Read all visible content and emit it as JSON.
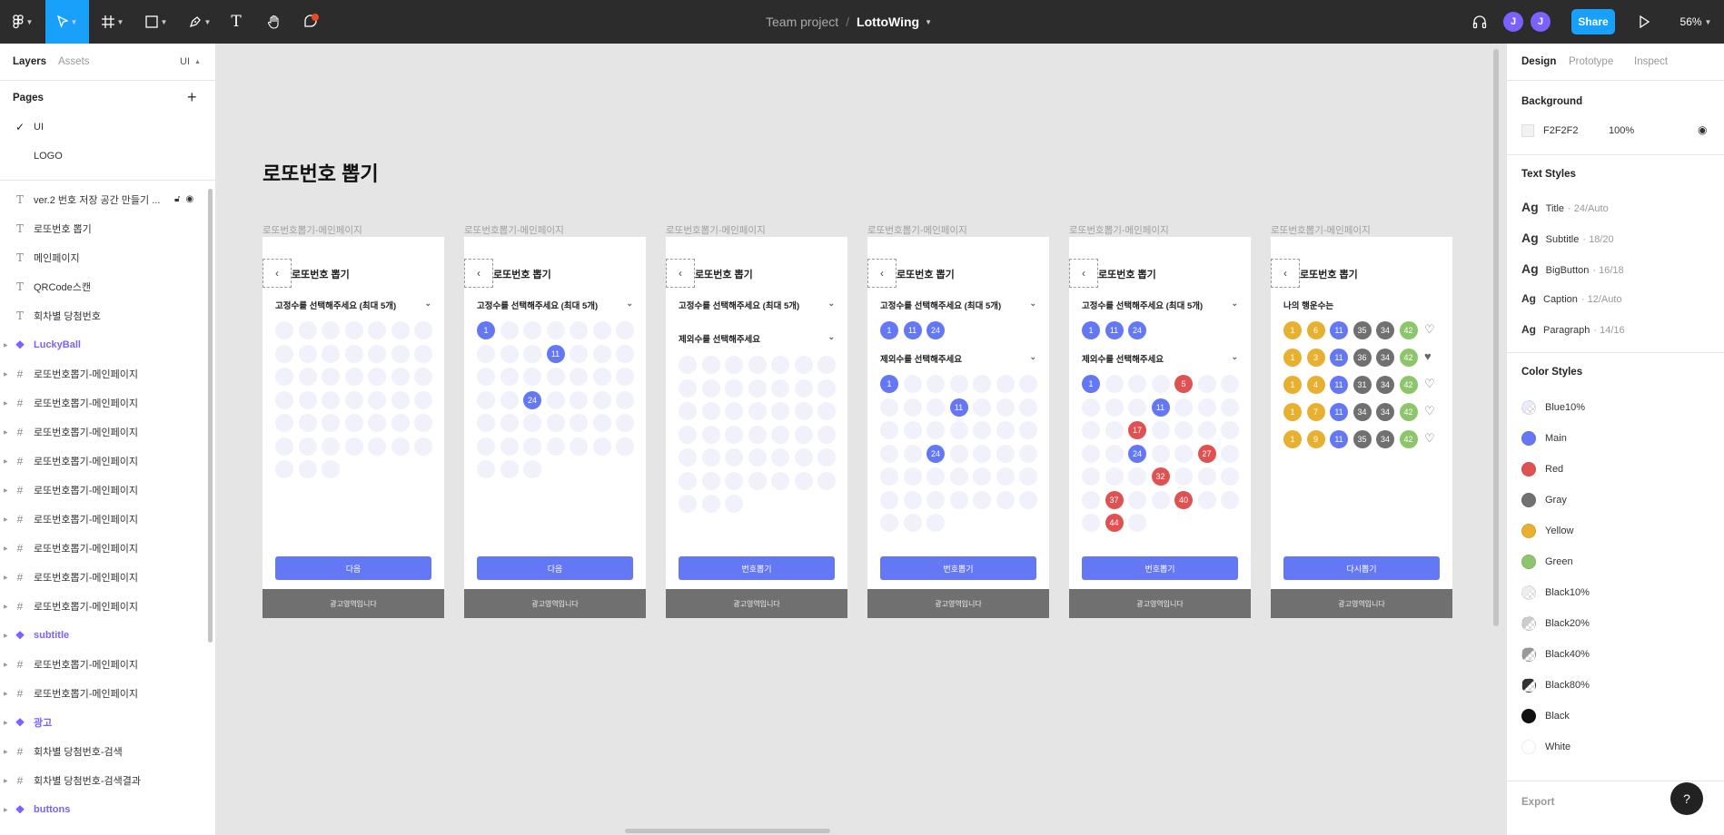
{
  "topbar": {
    "project": "Team project",
    "separator": "/",
    "file_name": "LottoWing",
    "avatars": [
      "J",
      "J"
    ],
    "share_label": "Share",
    "zoom": "56%"
  },
  "left_panel": {
    "tabs": {
      "layers": "Layers",
      "assets": "Assets",
      "page_select": "UI"
    },
    "pages_label": "Pages",
    "pages": [
      {
        "name": "UI",
        "selected": true
      },
      {
        "name": "LOGO",
        "selected": false
      }
    ],
    "layers": [
      {
        "type": "text",
        "name": "ver.2 번호 저장 공간 만들기 ..."
      },
      {
        "type": "text",
        "name": "로또번호 뽑기"
      },
      {
        "type": "text",
        "name": "메인페이지"
      },
      {
        "type": "text",
        "name": "QRCode스캔"
      },
      {
        "type": "text",
        "name": "회차별 당첨번호"
      },
      {
        "type": "component",
        "name": "LuckyBall"
      },
      {
        "type": "frame",
        "name": "로또번호뽑기-메인페이지"
      },
      {
        "type": "frame",
        "name": "로또번호뽑기-메인페이지"
      },
      {
        "type": "frame",
        "name": "로또번호뽑기-메인페이지"
      },
      {
        "type": "frame",
        "name": "로또번호뽑기-메인페이지"
      },
      {
        "type": "frame",
        "name": "로또번호뽑기-메인페이지"
      },
      {
        "type": "frame",
        "name": "로또번호뽑기-메인페이지"
      },
      {
        "type": "frame",
        "name": "로또번호뽑기-메인페이지"
      },
      {
        "type": "frame",
        "name": "로또번호뽑기-메인페이지"
      },
      {
        "type": "frame",
        "name": "로또번호뽑기-메인페이지"
      },
      {
        "type": "component",
        "name": "subtitle"
      },
      {
        "type": "frame",
        "name": "로또번호뽑기-메인페이지"
      },
      {
        "type": "frame",
        "name": "로또번호뽑기-메인페이지"
      },
      {
        "type": "component",
        "name": "광고"
      },
      {
        "type": "frame",
        "name": "회차별 당첨번호-검색"
      },
      {
        "type": "frame",
        "name": "회차별 당첨번호-검색결과"
      },
      {
        "type": "component",
        "name": "buttons"
      }
    ]
  },
  "canvas": {
    "heading": "로또번호 뽑기",
    "frames": [
      {
        "label": "로또번호뽑기-메인페이지",
        "title": "로또번호 뽑기",
        "drop1": "고정수를 선택해주세요 (최대 5개)",
        "drop2": "",
        "button": "다음",
        "ad": "광고영역입니다",
        "mode": "grid1",
        "selected": []
      },
      {
        "label": "로또번호뽑기-메인페이지",
        "title": "로또번호 뽑기",
        "drop1": "고정수를 선택해주세요 (최대 5개)",
        "drop2": "",
        "button": "다음",
        "ad": "광고영역입니다",
        "mode": "grid1",
        "selected": [
          1,
          11,
          24
        ]
      },
      {
        "label": "로또번호뽑기-메인페이지",
        "title": "로또번호 뽑기",
        "drop1": "고정수를 선택해주세요 (최대 5개)",
        "drop2": "제외수를 선택해주세요",
        "button": "번호뽑기",
        "ad": "광고영역입니다",
        "mode": "grid2",
        "selected": []
      },
      {
        "label": "로또번호뽑기-메인페이지",
        "title": "로또번호 뽑기",
        "drop1": "고정수를 선택해주세요 (최대 5개)",
        "drop2": "제외수를 선택해주세요",
        "button": "번호뽑기",
        "ad": "광고영역입니다",
        "mode": "grid3",
        "fixed": [
          1,
          11,
          24
        ],
        "selected": [
          1,
          11,
          24
        ],
        "excluded": []
      },
      {
        "label": "로또번호뽑기-메인페이지",
        "title": "로또번호 뽑기",
        "drop1": "고정수를 선택해주세요 (최대 5개)",
        "drop2": "제외수를 선택해주세요",
        "button": "번호뽑기",
        "ad": "광고영역입니다",
        "mode": "grid3",
        "fixed": [
          1,
          11,
          24
        ],
        "selected": [
          1,
          11,
          24
        ],
        "excluded": [
          5,
          17,
          27,
          32,
          37,
          40,
          44
        ]
      },
      {
        "label": "로또번호뽑기-메인페이지",
        "title": "로또번호 뽑기",
        "drop1": "나의 행운수는",
        "drop2": "",
        "button": "다시뽑기",
        "ad": "광고영역입니다",
        "mode": "result",
        "rows": [
          [
            1,
            6,
            11,
            35,
            34,
            42
          ],
          [
            1,
            3,
            11,
            36,
            34,
            42
          ],
          [
            1,
            4,
            11,
            31,
            34,
            42
          ],
          [
            1,
            7,
            11,
            34,
            34,
            42
          ],
          [
            1,
            9,
            11,
            35,
            34,
            42
          ]
        ],
        "row_colors": [
          [
            "yellow",
            "yellow",
            "main",
            "gray",
            "gray",
            "green"
          ],
          [
            "yellow",
            "yellow",
            "main",
            "gray",
            "gray",
            "green"
          ],
          [
            "yellow",
            "yellow",
            "main",
            "gray",
            "gray",
            "green"
          ],
          [
            "yellow",
            "yellow",
            "main",
            "gray",
            "gray",
            "green"
          ],
          [
            "yellow",
            "yellow",
            "main",
            "gray",
            "gray",
            "green"
          ]
        ],
        "liked": [
          false,
          true,
          false,
          false,
          false
        ]
      }
    ]
  },
  "right_panel": {
    "tabs": {
      "design": "Design",
      "prototype": "Prototype",
      "inspect": "Inspect"
    },
    "background_label": "Background",
    "background_hex": "F2F2F2",
    "background_opacity": "100%",
    "text_styles_label": "Text Styles",
    "text_styles": [
      {
        "ag": "Ag",
        "name": "Title",
        "spec": "· 24/Auto"
      },
      {
        "ag": "Ag",
        "name": "Subtitle",
        "spec": "· 18/20"
      },
      {
        "ag": "Ag",
        "name": "BigButton",
        "spec": "· 16/18"
      },
      {
        "ag": "Ag",
        "name": "Caption",
        "spec": "· 12/Auto"
      },
      {
        "ag": "Ag",
        "name": "Paragraph",
        "spec": "· 14/16"
      }
    ],
    "color_styles_label": "Color Styles",
    "color_styles": [
      {
        "name": "Blue10%",
        "color": "#e8ebfe",
        "pattern": true
      },
      {
        "name": "Main",
        "color": "#6477f5",
        "pattern": false
      },
      {
        "name": "Red",
        "color": "#e05252",
        "pattern": false
      },
      {
        "name": "Gray",
        "color": "#707070",
        "pattern": false
      },
      {
        "name": "Yellow",
        "color": "#e8b030",
        "pattern": false
      },
      {
        "name": "Green",
        "color": "#8cc56a",
        "pattern": false
      },
      {
        "name": "Black10%",
        "color": "#eeeeee",
        "pattern": true
      },
      {
        "name": "Black20%",
        "color": "#cccccc",
        "pattern": true
      },
      {
        "name": "Black40%",
        "color": "#999999",
        "pattern": true
      },
      {
        "name": "Black80%",
        "color": "#333333",
        "pattern": true
      },
      {
        "name": "Black",
        "color": "#111111",
        "pattern": false
      },
      {
        "name": "White",
        "color": "#ffffff",
        "pattern": false
      }
    ],
    "export_label": "Export",
    "help_label": "?"
  },
  "colors": {
    "main": "#6477f5",
    "red": "#e05252",
    "gray": "#707070",
    "yellow": "#e8b030",
    "green": "#8cc56a",
    "accent": "#7b61ff",
    "share": "#18a0fb"
  }
}
